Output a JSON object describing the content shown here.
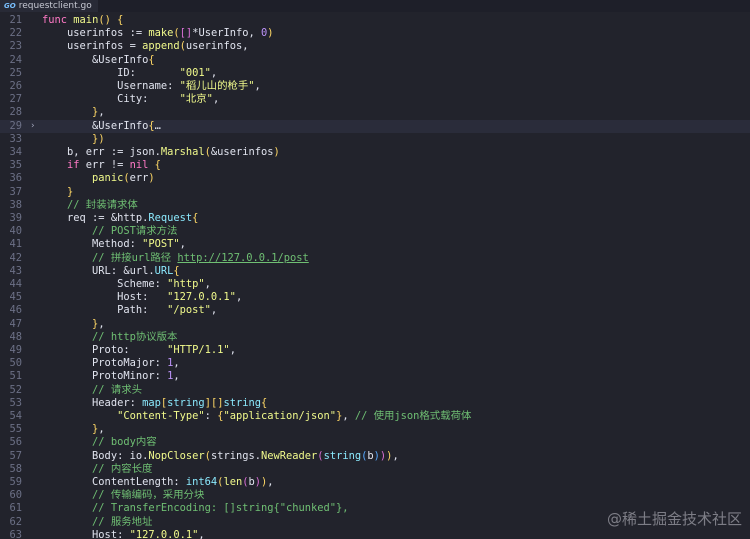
{
  "tab": {
    "icon": "go-file-icon",
    "icon_text": "GO",
    "title": "requestclient.go"
  },
  "watermark": "@稀土掘金技术社区",
  "lines": [
    {
      "n": "21",
      "c": "func main() {"
    },
    {
      "n": "22",
      "c": "    userinfos := make([]*UserInfo, 0)"
    },
    {
      "n": "23",
      "c": "    userinfos = append(userinfos,"
    },
    {
      "n": "24",
      "c": "        &UserInfo{"
    },
    {
      "n": "25",
      "c": "            ID:       \"001\","
    },
    {
      "n": "26",
      "c": "            Username: \"稻儿山的枪手\","
    },
    {
      "n": "27",
      "c": "            City:     \"北京\","
    },
    {
      "n": "28",
      "c": "        },"
    },
    {
      "n": "29",
      "c": "        &UserInfo{…",
      "fold": "›",
      "hl": true
    },
    {
      "n": "33",
      "c": "        })"
    },
    {
      "n": "34",
      "c": "    b, err := json.Marshal(&userinfos)"
    },
    {
      "n": "35",
      "c": "    if err != nil {"
    },
    {
      "n": "36",
      "c": "        panic(err)"
    },
    {
      "n": "37",
      "c": "    }"
    },
    {
      "n": "38",
      "c": "    // 封装请求体"
    },
    {
      "n": "39",
      "c": "    req := &http.Request{"
    },
    {
      "n": "40",
      "c": "        // POST请求方法"
    },
    {
      "n": "41",
      "c": "        Method: \"POST\","
    },
    {
      "n": "42",
      "c": "        // 拼接url路径 http://127.0.0.1/post"
    },
    {
      "n": "43",
      "c": "        URL: &url.URL{"
    },
    {
      "n": "44",
      "c": "            Scheme: \"http\","
    },
    {
      "n": "45",
      "c": "            Host:   \"127.0.0.1\","
    },
    {
      "n": "46",
      "c": "            Path:   \"/post\","
    },
    {
      "n": "47",
      "c": "        },"
    },
    {
      "n": "48",
      "c": "        // http协议版本"
    },
    {
      "n": "49",
      "c": "        Proto:      \"HTTP/1.1\","
    },
    {
      "n": "50",
      "c": "        ProtoMajor: 1,"
    },
    {
      "n": "51",
      "c": "        ProtoMinor: 1,"
    },
    {
      "n": "52",
      "c": "        // 请求头"
    },
    {
      "n": "53",
      "c": "        Header: map[string][]string{"
    },
    {
      "n": "54",
      "c": "            \"Content-Type\": {\"application/json\"}, // 使用json格式载荷体"
    },
    {
      "n": "55",
      "c": "        },"
    },
    {
      "n": "56",
      "c": "        // body内容"
    },
    {
      "n": "57",
      "c": "        Body: io.NopCloser(strings.NewReader(string(b))),"
    },
    {
      "n": "58",
      "c": "        // 内容长度"
    },
    {
      "n": "59",
      "c": "        ContentLength: int64(len(b)),"
    },
    {
      "n": "60",
      "c": "        // 传输编码，采用分块"
    },
    {
      "n": "61",
      "c": "        // TransferEncoding: []string{\"chunked\"},"
    },
    {
      "n": "62",
      "c": "        // 服务地址"
    },
    {
      "n": "63",
      "c": "        Host: \"127.0.0.1\","
    }
  ]
}
